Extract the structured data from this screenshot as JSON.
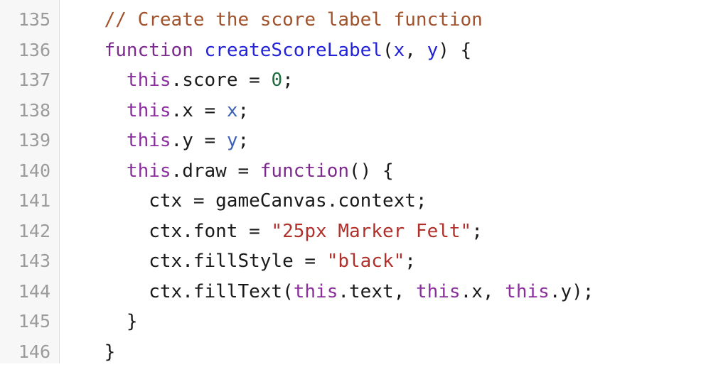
{
  "editor": {
    "language": "JavaScript",
    "gutter_background": "#f7f7f7",
    "gutter_border_color": "#dedede",
    "code_background": "#ffffff",
    "line_number_color": "#9b9b9b",
    "first_line_number": 135,
    "last_line_number": 146,
    "palette": {
      "plain": "#1a1a1a",
      "comment": "#a0522d",
      "keyword": "#7d2a8f",
      "this": "#8b2f9e",
      "function_name": "#2222d8",
      "parameter": "#2222d8",
      "variable": "#3b62b8",
      "number": "#1d6b3f",
      "string": "#b0302b"
    }
  },
  "lines": [
    {
      "number": "135",
      "indent": "    ",
      "tokens": [
        {
          "text": "// Create the score label function",
          "kind": "comment"
        }
      ]
    },
    {
      "number": "136",
      "indent": "    ",
      "tokens": [
        {
          "text": "function",
          "kind": "keyword"
        },
        {
          "text": " ",
          "kind": "plain"
        },
        {
          "text": "createScoreLabel",
          "kind": "funcname"
        },
        {
          "text": "(",
          "kind": "plain"
        },
        {
          "text": "x",
          "kind": "param"
        },
        {
          "text": ", ",
          "kind": "plain"
        },
        {
          "text": "y",
          "kind": "param"
        },
        {
          "text": ") {",
          "kind": "plain"
        }
      ]
    },
    {
      "number": "137",
      "indent": "      ",
      "tokens": [
        {
          "text": "this",
          "kind": "this"
        },
        {
          "text": ".score = ",
          "kind": "plain"
        },
        {
          "text": "0",
          "kind": "number"
        },
        {
          "text": ";",
          "kind": "plain"
        }
      ]
    },
    {
      "number": "138",
      "indent": "      ",
      "tokens": [
        {
          "text": "this",
          "kind": "this"
        },
        {
          "text": ".x = ",
          "kind": "plain"
        },
        {
          "text": "x",
          "kind": "var"
        },
        {
          "text": ";",
          "kind": "plain"
        }
      ]
    },
    {
      "number": "139",
      "indent": "      ",
      "tokens": [
        {
          "text": "this",
          "kind": "this"
        },
        {
          "text": ".y = ",
          "kind": "plain"
        },
        {
          "text": "y",
          "kind": "var"
        },
        {
          "text": ";",
          "kind": "plain"
        }
      ]
    },
    {
      "number": "140",
      "indent": "      ",
      "tokens": [
        {
          "text": "this",
          "kind": "this"
        },
        {
          "text": ".draw = ",
          "kind": "plain"
        },
        {
          "text": "function",
          "kind": "keyword"
        },
        {
          "text": "() {",
          "kind": "plain"
        }
      ]
    },
    {
      "number": "141",
      "indent": "        ",
      "tokens": [
        {
          "text": "ctx = gameCanvas.context;",
          "kind": "plain"
        }
      ]
    },
    {
      "number": "142",
      "indent": "        ",
      "tokens": [
        {
          "text": "ctx.font = ",
          "kind": "plain"
        },
        {
          "text": "\"25px Marker Felt\"",
          "kind": "string"
        },
        {
          "text": ";",
          "kind": "plain"
        }
      ]
    },
    {
      "number": "143",
      "indent": "        ",
      "tokens": [
        {
          "text": "ctx.fillStyle = ",
          "kind": "plain"
        },
        {
          "text": "\"black\"",
          "kind": "string"
        },
        {
          "text": ";",
          "kind": "plain"
        }
      ]
    },
    {
      "number": "144",
      "indent": "        ",
      "tokens": [
        {
          "text": "ctx.fillText(",
          "kind": "plain"
        },
        {
          "text": "this",
          "kind": "this"
        },
        {
          "text": ".text, ",
          "kind": "plain"
        },
        {
          "text": "this",
          "kind": "this"
        },
        {
          "text": ".x, ",
          "kind": "plain"
        },
        {
          "text": "this",
          "kind": "this"
        },
        {
          "text": ".y);",
          "kind": "plain"
        }
      ]
    },
    {
      "number": "145",
      "indent": "      ",
      "tokens": [
        {
          "text": "}",
          "kind": "plain"
        }
      ]
    },
    {
      "number": "146",
      "indent": "    ",
      "tokens": [
        {
          "text": "}",
          "kind": "plain"
        }
      ]
    }
  ]
}
